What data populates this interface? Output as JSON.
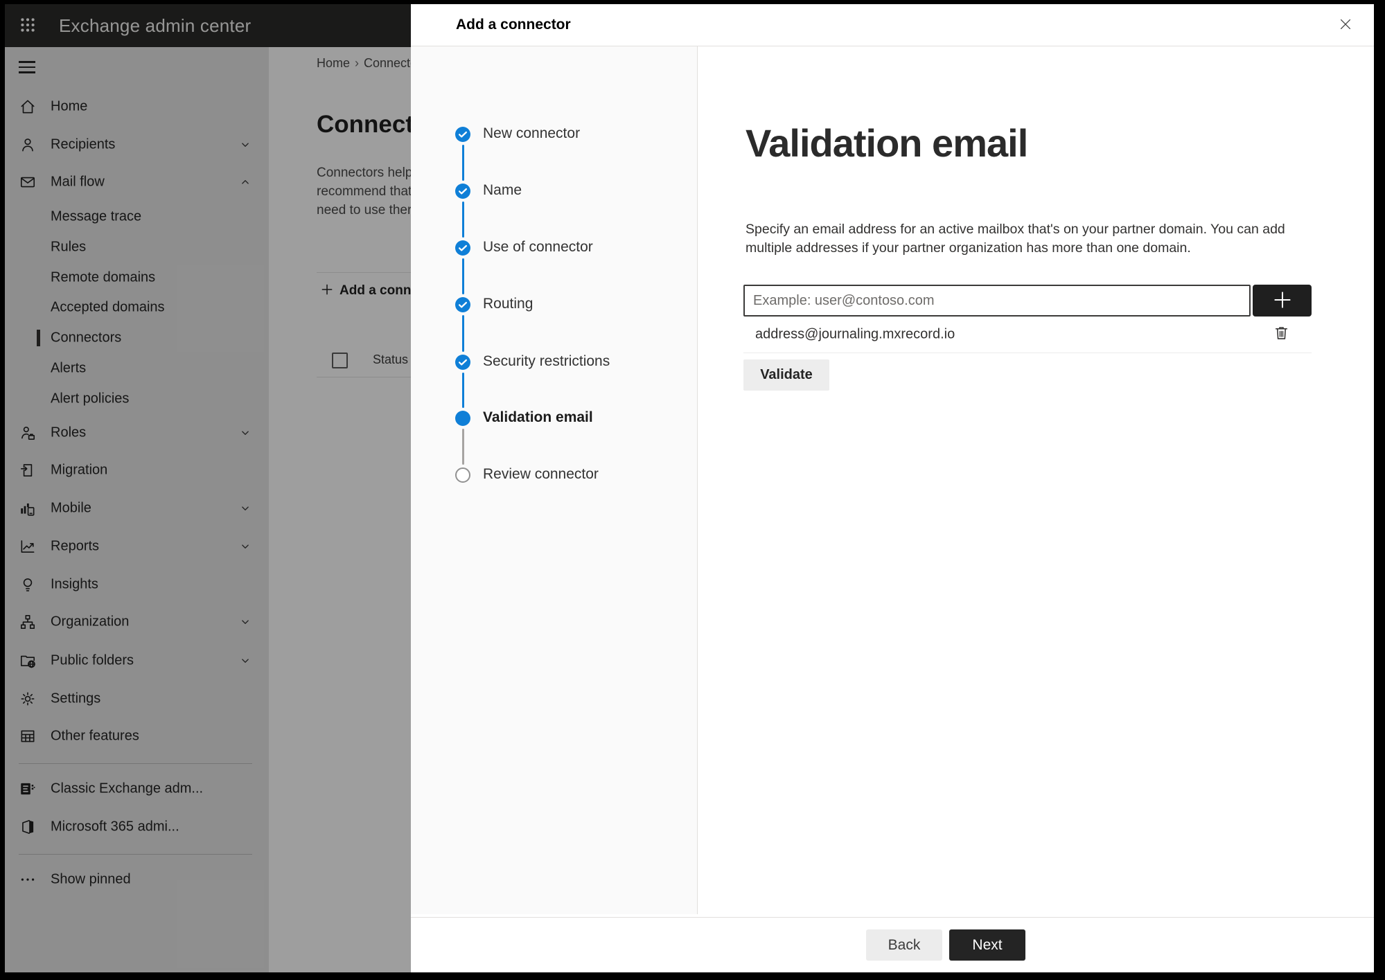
{
  "topbar": {
    "title": "Exchange admin center"
  },
  "sidebar": {
    "items": [
      {
        "label": "Home",
        "icon": "home"
      },
      {
        "label": "Recipients",
        "icon": "person",
        "chevron": "down"
      },
      {
        "label": "Mail flow",
        "icon": "mail",
        "chevron": "up"
      },
      {
        "label": "Message trace",
        "sub": true
      },
      {
        "label": "Rules",
        "sub": true
      },
      {
        "label": "Remote domains",
        "sub": true
      },
      {
        "label": "Accepted domains",
        "sub": true
      },
      {
        "label": "Connectors",
        "sub": true,
        "selected": true
      },
      {
        "label": "Alerts",
        "sub": true
      },
      {
        "label": "Alert policies",
        "sub": true
      },
      {
        "label": "Roles",
        "icon": "roles",
        "chevron": "down"
      },
      {
        "label": "Migration",
        "icon": "migration"
      },
      {
        "label": "Mobile",
        "icon": "mobile",
        "chevron": "down"
      },
      {
        "label": "Reports",
        "icon": "reports",
        "chevron": "down"
      },
      {
        "label": "Insights",
        "icon": "insights"
      },
      {
        "label": "Organization",
        "icon": "organization",
        "chevron": "down"
      },
      {
        "label": "Public folders",
        "icon": "public-folders",
        "chevron": "down"
      },
      {
        "label": "Settings",
        "icon": "settings"
      },
      {
        "label": "Other features",
        "icon": "other-features"
      },
      {
        "divider": true
      },
      {
        "label": "Classic Exchange adm...",
        "icon": "classic-exchange"
      },
      {
        "label": "Microsoft 365 admi...",
        "icon": "m365"
      },
      {
        "divider": true
      },
      {
        "label": "Show pinned",
        "icon": "more"
      }
    ]
  },
  "page": {
    "breadcrumb": {
      "home": "Home",
      "current": "Connectors"
    },
    "title": "Connectors",
    "intro_lines": [
      "Connectors help",
      "recommend that",
      "need to use ther"
    ],
    "add_button_label": "Add a connector",
    "status_header": "Status"
  },
  "modal": {
    "title": "Add a connector",
    "steps": [
      {
        "label": "New connector",
        "state": "done"
      },
      {
        "label": "Name",
        "state": "done"
      },
      {
        "label": "Use of connector",
        "state": "done"
      },
      {
        "label": "Routing",
        "state": "done"
      },
      {
        "label": "Security restrictions",
        "state": "done"
      },
      {
        "label": "Validation email",
        "state": "current"
      },
      {
        "label": "Review connector",
        "state": "todo"
      }
    ],
    "heading": "Validation email",
    "description_lines": [
      "Specify an email address for an active mailbox that's on your partner domain. You can add",
      "multiple addresses if your partner organization has more than one domain."
    ],
    "email_input": {
      "value": "",
      "placeholder": "Example: user@contoso.com"
    },
    "addresses": [
      "address@journaling.mxrecord.io"
    ],
    "validate_label": "Validate",
    "back_label": "Back",
    "next_label": "Next"
  },
  "colors": {
    "accent_blue": "#0f7fd7",
    "topbar_bg": "#2b2a29",
    "sidebar_bg": "#e6e6e6",
    "modal_bg": "#ffffff",
    "dark_button_bg": "#1f1f1f",
    "next_button_bg": "#242424",
    "validate_button_bg": "#ededed",
    "todo_circle_border": "#919191",
    "dim_overlay": "rgba(0,0,0,0.38)"
  }
}
